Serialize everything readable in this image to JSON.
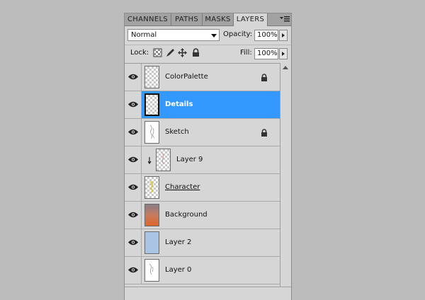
{
  "tabs": [
    "CHANNELS",
    "PATHS",
    "MASKS",
    "LAYERS"
  ],
  "active_tab": "LAYERS",
  "blend_mode": "Normal",
  "opacity_label": "Opacity:",
  "opacity_value": "100%",
  "lock_label": "Lock:",
  "fill_label": "Fill:",
  "fill_value": "100%",
  "layers": [
    {
      "name": "ColorPalette",
      "visible": true,
      "locked": true,
      "selected": false,
      "thumb": "checker-dots"
    },
    {
      "name": "Details",
      "visible": true,
      "locked": false,
      "selected": true,
      "thumb": "checker"
    },
    {
      "name": "Sketch",
      "visible": true,
      "locked": true,
      "selected": false,
      "thumb": "sketch"
    },
    {
      "name": "Layer 9",
      "visible": true,
      "locked": false,
      "selected": false,
      "clipped": true,
      "thumb": "checker-sketch"
    },
    {
      "name": "Character",
      "visible": true,
      "locked": false,
      "selected": false,
      "underlined": true,
      "thumb": "character"
    },
    {
      "name": "Background",
      "visible": true,
      "locked": false,
      "selected": false,
      "thumb": "gradient-orange"
    },
    {
      "name": "Layer 2",
      "visible": true,
      "locked": false,
      "selected": false,
      "thumb": "solid-blue"
    },
    {
      "name": "Layer 0",
      "visible": true,
      "locked": false,
      "selected": false,
      "thumb": "sketch"
    }
  ],
  "colors": {
    "selection": "#3399ff",
    "panel_bg": "#d6d6d6",
    "page_bg": "#bcbcbc",
    "layer2_fill": "#a9c4e4"
  }
}
